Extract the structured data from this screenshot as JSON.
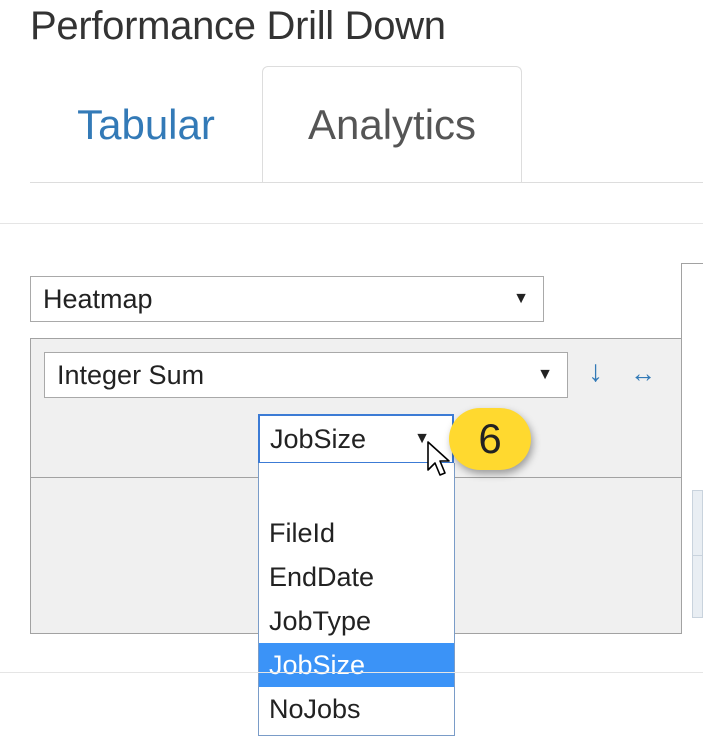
{
  "page": {
    "title": "Performance Drill Down"
  },
  "tabs": [
    {
      "label": "Tabular",
      "active": false
    },
    {
      "label": "Analytics",
      "active": true
    }
  ],
  "renderer": {
    "value": "Heatmap"
  },
  "aggregator": {
    "value": "Integer Sum",
    "sort_icon": "down-arrow-icon",
    "swap_icon": "left-right-arrow-icon"
  },
  "attribute_select": {
    "value": "JobSize",
    "options": [
      "",
      "FileId",
      "EndDate",
      "JobType",
      "JobSize",
      "NoJobs"
    ],
    "selected": "JobSize"
  },
  "callout": {
    "number": "6",
    "color": "#ffd92f"
  },
  "colors": {
    "link": "#337ab7",
    "selection": "#3b93f7",
    "panel": "#f0f0f0"
  }
}
